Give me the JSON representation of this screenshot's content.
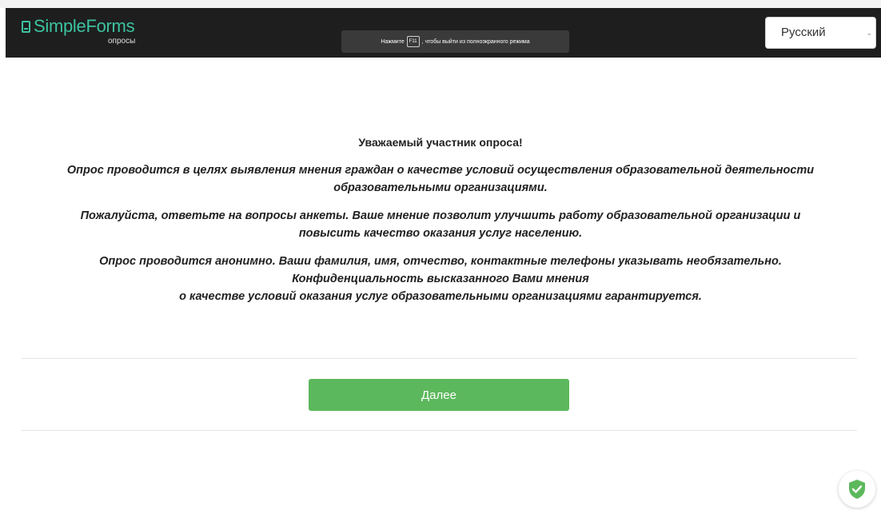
{
  "header": {
    "logo_text": "SimpleForms",
    "logo_subtitle": "опросы",
    "fullscreen_note_before": "Нажмите",
    "fullscreen_note_key": "F11",
    "fullscreen_note_after": ", чтобы выйти из полноэкранного режима",
    "language_selected": "Русский",
    "logo_color": "#3cc3a0",
    "background_color": "#1e1e1e"
  },
  "intro": {
    "greeting": "Уважаемый участник опроса!",
    "paragraph_1_line_1": "Опрос проводится в целях выявления мнения граждан о качестве условий осуществления образовательной деятельности",
    "paragraph_1_line_2": "образовательными организациями.",
    "paragraph_2_line_1": "Пожалуйста, ответьте на вопросы анкеты. Ваше мнение позволит улучшить работу образовательной организации и",
    "paragraph_2_line_2": "повысить качество оказания услуг населению.",
    "paragraph_3_line_1": "Опрос проводится анонимно. Ваши фамилия, имя, отчество, контактные телефоны указывать необязательно.",
    "paragraph_3_line_2": "Конфиденциальность высказанного Вами мнения",
    "paragraph_3_line_3": "о качестве условий оказания услуг образовательными организациями гарантируется."
  },
  "actions": {
    "next_label": "Далее",
    "next_color": "#5cb85c"
  },
  "badge": {
    "icon": "shield-check-icon",
    "color": "#5cb85c"
  }
}
